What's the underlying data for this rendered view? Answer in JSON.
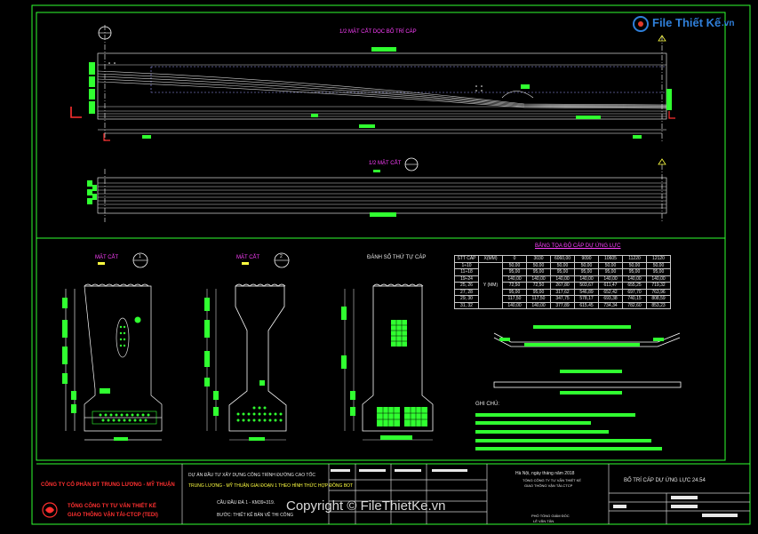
{
  "logo": {
    "text": "File Thiết Kế",
    "domain": ".vn"
  },
  "top_view": {
    "title": "1/2 MẶT CẮT DỌC BỐ TRÍ CÁP"
  },
  "bottom_view": {
    "title": "1/2 MẶT CẮT"
  },
  "sections": [
    {
      "title": "MẶT CẮT",
      "num": "1"
    },
    {
      "title": "MẶT CẮT",
      "num": "2"
    },
    {
      "title": "ĐÁNH SỐ THỨ TỰ CÁP"
    }
  ],
  "table": {
    "title": "BẢNG TỌA ĐỘ CÁP DỰ ỨNG LỰC",
    "header": [
      "STT CÁP",
      "X(MM)",
      "0",
      "3030",
      "6060,00",
      "9090",
      "10605",
      "11220",
      "12120"
    ],
    "y_label": "Y (MM)",
    "rows": [
      [
        "1÷10",
        "50,00",
        "50,00",
        "50,00",
        "50,00",
        "50,00",
        "50,00",
        "50,00"
      ],
      [
        "11÷18",
        "95,00",
        "95,00",
        "95,00",
        "95,00",
        "95,00",
        "95,00",
        "95,00"
      ],
      [
        "19÷24",
        "140,00",
        "140,00",
        "140,00",
        "140,00",
        "140,00",
        "140,00",
        "140,00"
      ],
      [
        "25, 26",
        "72,50",
        "72,50",
        "267,80",
        "503,67",
        "611,47",
        "655,25",
        "719,32"
      ],
      [
        "27, 28",
        "95,00",
        "95,00",
        "317,62",
        "546,89",
        "652,42",
        "697,70",
        "763,96"
      ],
      [
        "29, 30",
        "117,50",
        "117,50",
        "347,75",
        "578,17",
        "693,38",
        "740,15",
        "808,59"
      ],
      [
        "31, 32",
        "140,00",
        "140,00",
        "377,89",
        "615,45",
        "734,34",
        "782,60",
        "853,23"
      ]
    ]
  },
  "notes": {
    "title": "GHI CHÚ:"
  },
  "title_block": {
    "company1": "CÔNG TY CỔ PHẦN ĐT TRUNG LƯƠNG - MỸ THUẬN",
    "company2": "TỔNG CÔNG TY TƯ VẤN THIẾT KẾ",
    "company3": "GIAO THÔNG VẬN TẢI-CTCP (TEDI)",
    "project1": "DỰ ÁN ĐẦU TƯ XÂY DỰNG CÔNG TRÌNH ĐƯỜNG CAO TỐC",
    "project2": "TRUNG LƯƠNG - MỸ THUẬN GIAI ĐOẠN 1 THEO HÌNH THỨC HỢP ĐỒNG BOT",
    "package": "CẦU ĐẦU ĐÀ 1 - KM39+319.",
    "stage": "BƯỚC: THIẾT KẾ BẢN VẼ THI CÔNG",
    "date_line": "Hà Nội, ngày    tháng    năm 2018",
    "drawing_title": "BỐ TRÍ CÁP DỰ ỨNG LỰC 24.54",
    "small1": "TỔNG CÔNG TY TƯ VẤN THIẾT KẾ",
    "small2": "GIAO THÔNG VẬN TẢI-CTCP",
    "small3": "PHÓ TỔNG GIÁM ĐỐC",
    "small4": "LÊ VĂN TÂN"
  },
  "watermark": "Copyright © FileThietKe.vn"
}
